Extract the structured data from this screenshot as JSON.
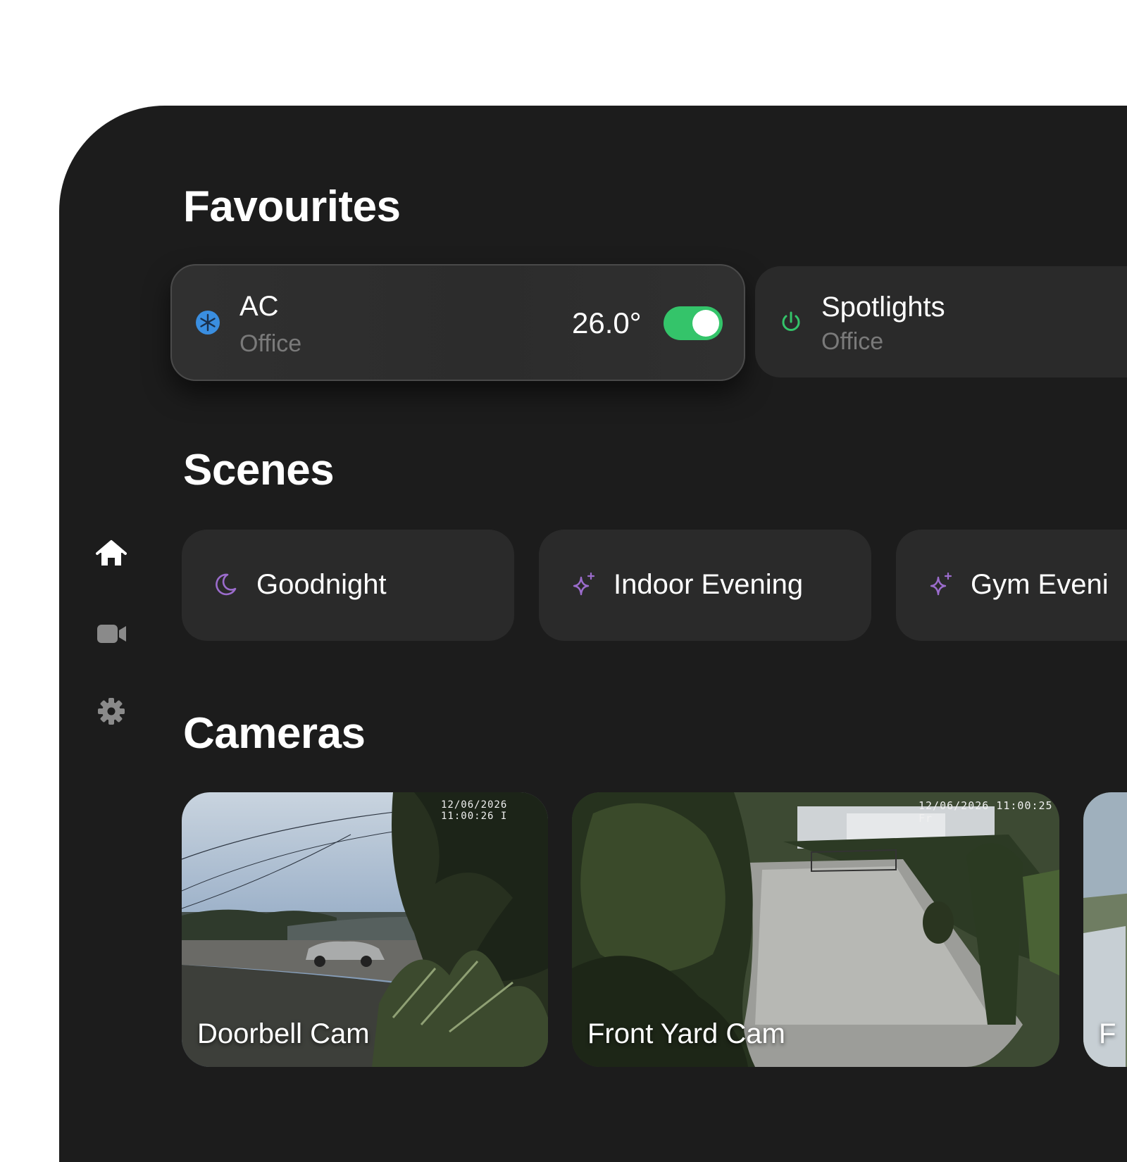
{
  "sidebar": {
    "items": [
      {
        "icon": "home-icon",
        "active": true
      },
      {
        "icon": "video-camera-icon",
        "active": false
      },
      {
        "icon": "gear-icon",
        "active": false
      }
    ]
  },
  "favourites": {
    "title": "Favourites",
    "items": [
      {
        "name": "AC",
        "room": "Office",
        "icon": "snowflake-icon",
        "value": "26.0°",
        "toggle_on": true
      },
      {
        "name": "Spotlights",
        "room": "Office",
        "icon": "power-icon"
      }
    ]
  },
  "scenes": {
    "title": "Scenes",
    "items": [
      {
        "label": "Goodnight",
        "icon": "moon-icon"
      },
      {
        "label": "Indoor Evening",
        "icon": "sparkle-icon"
      },
      {
        "label": "Gym Eveni",
        "icon": "sparkle-icon"
      }
    ]
  },
  "cameras": {
    "title": "Cameras",
    "items": [
      {
        "label": "Doorbell Cam",
        "timestamp": "12/06/2026 11:00:26 I"
      },
      {
        "label": "Front Yard Cam",
        "timestamp": "12/06/2026 11:00:25 Fr"
      },
      {
        "label": "F",
        "timestamp": ""
      }
    ]
  },
  "colors": {
    "background": "#1c1c1c",
    "card": "#2a2a2a",
    "toggle_on": "#34c46a",
    "ac_icon": "#3a8ee0",
    "power_icon": "#34c46a",
    "scene_icon": "#9b6ccc",
    "subtitle": "#7a7a7a"
  }
}
